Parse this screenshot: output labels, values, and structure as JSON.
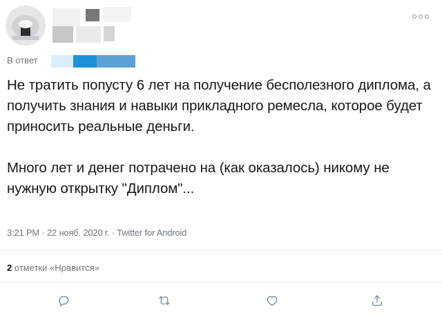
{
  "tweet": {
    "reply_prefix": "В ответ",
    "paragraphs": [
      "Не тратить попусту 6 лет на получение бесполезного диплома, а получить знания и навыки прикладного ремесла, которое будет приносить реальные деньги.",
      "Много лет и денег потрачено на (как оказалось) никому не нужную открытку \"Диплом\"..."
    ],
    "timestamp": "3:21 PM · 22 нояб. 2020 г. · Twitter for Android",
    "likes_count": "2",
    "likes_label": "отметки «Нравится»"
  },
  "icons": {
    "more": "more-icon",
    "reply": "reply-icon",
    "retweet": "retweet-icon",
    "like": "like-icon",
    "share": "share-icon"
  },
  "colors": {
    "text": "#0f1419",
    "secondary": "#6e767d",
    "icon": "#7a8a96",
    "divider": "#e7eaec"
  }
}
